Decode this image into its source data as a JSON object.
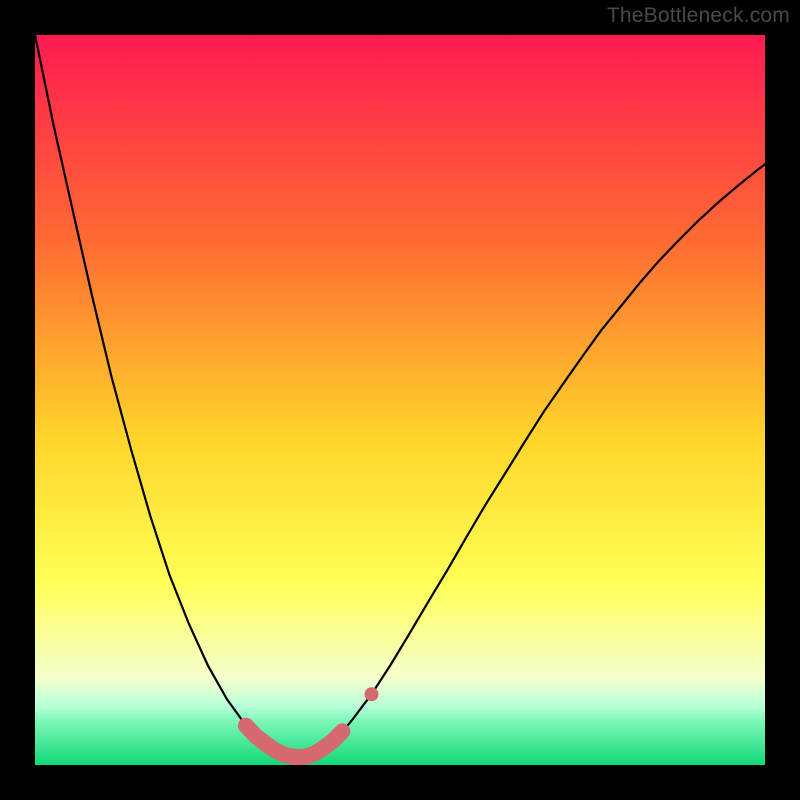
{
  "watermark": "TheBottleneck.com",
  "colors": {
    "page_bg": "#000000",
    "curve": "#000000",
    "markers_fill": "#d46a6f",
    "markers_stroke": "#d46a6f",
    "grad_top": "#ff1a52",
    "grad_mid1": "#ff7a2f",
    "grad_mid2": "#ffd42a",
    "grad_mid3": "#ffff55",
    "grad_low": "#f5ffcc",
    "grad_band": "#9cffc8",
    "grad_bottom": "#10d977"
  },
  "chart_data": {
    "type": "line",
    "title": "",
    "xlabel": "",
    "ylabel": "",
    "xlim": [
      0,
      1
    ],
    "ylim": [
      0,
      1
    ],
    "note": "Axes are not labeled in the source image; x/y are normalized 0–1 across the plotted gradient panel. The curve is a V-shaped bottleneck profile with its minimum near x≈0.34.",
    "series": [
      {
        "name": "bottleneck-curve",
        "x": [
          0.0,
          0.026,
          0.053,
          0.079,
          0.105,
          0.132,
          0.158,
          0.184,
          0.211,
          0.237,
          0.263,
          0.289,
          0.302,
          0.316,
          0.329,
          0.342,
          0.355,
          0.368,
          0.382,
          0.395,
          0.408,
          0.421,
          0.434,
          0.461,
          0.487,
          0.513,
          0.539,
          0.566,
          0.592,
          0.618,
          0.645,
          0.671,
          0.697,
          0.724,
          0.75,
          0.776,
          0.803,
          0.829,
          0.855,
          0.882,
          0.908,
          0.934,
          0.961,
          0.987,
          1.0
        ],
        "y": [
          1.0,
          0.874,
          0.754,
          0.639,
          0.531,
          0.431,
          0.341,
          0.261,
          0.193,
          0.136,
          0.09,
          0.054,
          0.04,
          0.029,
          0.02,
          0.014,
          0.011,
          0.011,
          0.015,
          0.023,
          0.033,
          0.046,
          0.061,
          0.097,
          0.137,
          0.18,
          0.224,
          0.269,
          0.314,
          0.358,
          0.401,
          0.443,
          0.484,
          0.523,
          0.56,
          0.596,
          0.629,
          0.661,
          0.691,
          0.719,
          0.745,
          0.769,
          0.792,
          0.813,
          0.823
        ]
      }
    ],
    "markers": {
      "name": "highlighted-points",
      "style": "thick-rounded-segment",
      "x": [
        0.289,
        0.302,
        0.316,
        0.329,
        0.342,
        0.355,
        0.368,
        0.382,
        0.395,
        0.408,
        0.421
      ],
      "y": [
        0.054,
        0.04,
        0.029,
        0.02,
        0.014,
        0.011,
        0.011,
        0.015,
        0.023,
        0.033,
        0.046
      ]
    },
    "isolated_marker": {
      "x": 0.461,
      "y": 0.097
    }
  }
}
